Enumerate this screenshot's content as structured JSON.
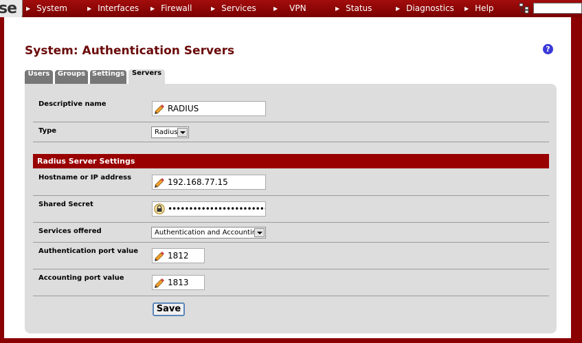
{
  "nav": {
    "items": [
      {
        "label": "System"
      },
      {
        "label": "Interfaces"
      },
      {
        "label": "Firewall"
      },
      {
        "label": "Services"
      },
      {
        "label": "VPN"
      },
      {
        "label": "Status"
      },
      {
        "label": "Diagnostics"
      },
      {
        "label": "Help"
      }
    ],
    "logo_fragment": "se"
  },
  "page": {
    "title": "System: Authentication Servers",
    "help_icon": "?"
  },
  "tabs": [
    {
      "label": "Users"
    },
    {
      "label": "Groups"
    },
    {
      "label": "Settings"
    },
    {
      "label": "Servers",
      "active": true
    }
  ],
  "form": {
    "descriptive_name": {
      "label": "Descriptive name",
      "value": "RADIUS"
    },
    "type": {
      "label": "Type",
      "value": "Radius"
    },
    "radius_section": {
      "header": "Radius Server Settings"
    },
    "hostname": {
      "label": "Hostname or IP address",
      "value": "192.168.77.15"
    },
    "shared_secret": {
      "label": "Shared Secret",
      "value": "••••••••••••••••••••••••"
    },
    "services_offered": {
      "label": "Services offered",
      "value": "Authentication and Accounting"
    },
    "auth_port": {
      "label": "Authentication port value",
      "value": "1812"
    },
    "acct_port": {
      "label": "Accounting port value",
      "value": "1813"
    },
    "save_label": "Save"
  },
  "colors": {
    "brand_red": "#990000",
    "title_red": "#6b0a0a",
    "panel_gray": "#dddddd",
    "help_blue": "#3a3adb"
  }
}
